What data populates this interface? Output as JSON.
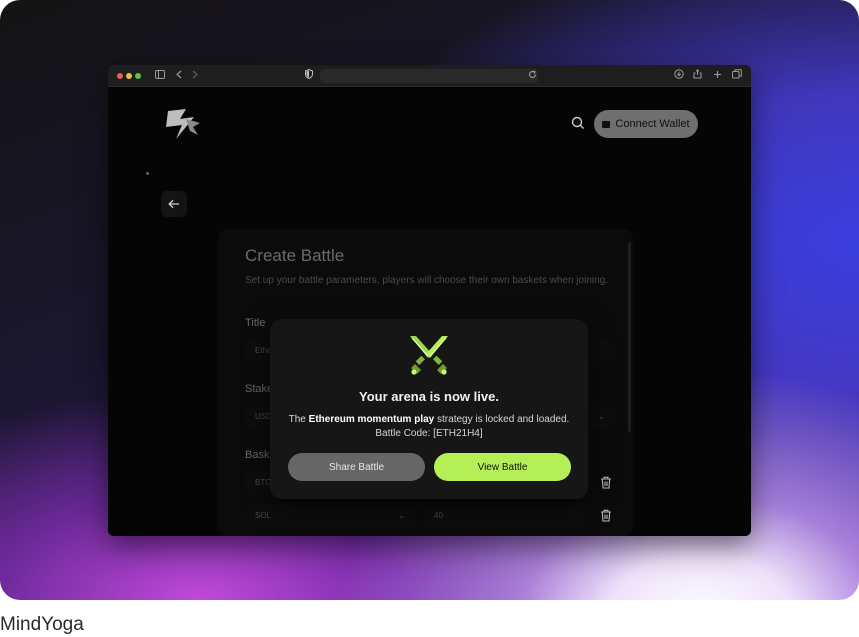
{
  "caption": "MindYoga",
  "browser": {
    "icons": [
      "sidebar-icon",
      "back-icon",
      "forward-icon",
      "shield-icon",
      "reload-icon",
      "download-icon",
      "share-icon",
      "new-tab-icon",
      "tabs-icon"
    ]
  },
  "header": {
    "connect_label": "Connect Wallet"
  },
  "form": {
    "title": "Create Battle",
    "subtitle": "Set up your battle parameters, players will choose their own baskets when joining.",
    "title_label": "Title",
    "title_value": "Ethe",
    "stake_label": "Stake",
    "stake_value": "USD",
    "basket_label": "Baske",
    "rows": [
      {
        "asset": "BTC",
        "amount": ""
      },
      {
        "asset": "SOL",
        "amount": "40"
      }
    ]
  },
  "modal": {
    "title": "Your arena is now live.",
    "desc_prefix": "The ",
    "desc_strategy": "Ethereum momentum play",
    "desc_suffix": " strategy is locked and loaded.",
    "code_line": "Battle Code: [ETH21H4]",
    "share_label": "Share Battle",
    "view_label": "View Battle"
  },
  "colors": {
    "accent": "#b4ef58",
    "modal_bg": "#161616",
    "page_bg": "#050505"
  }
}
